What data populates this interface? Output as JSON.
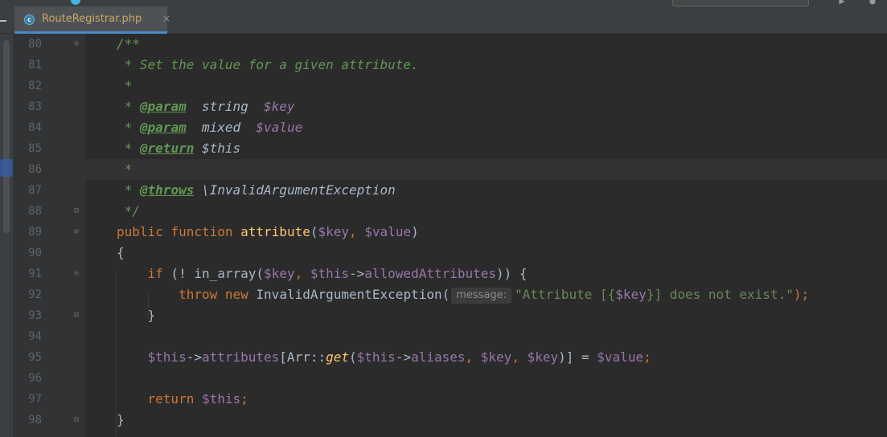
{
  "topbar": {
    "breadcrumb_text": "\\ ... \\ ... > ..."
  },
  "tab": {
    "icon_letter": "c",
    "title": "RouteRegistrar.php",
    "close_glyph": "×"
  },
  "editor": {
    "lines": [
      {
        "num": "80"
      },
      {
        "num": "81"
      },
      {
        "num": "82"
      },
      {
        "num": "83"
      },
      {
        "num": "84"
      },
      {
        "num": "85"
      },
      {
        "num": "86"
      },
      {
        "num": "87"
      },
      {
        "num": "88"
      },
      {
        "num": "89"
      },
      {
        "num": "90"
      },
      {
        "num": "91"
      },
      {
        "num": "92"
      },
      {
        "num": "93"
      },
      {
        "num": "94"
      },
      {
        "num": "95"
      },
      {
        "num": "96"
      },
      {
        "num": "97"
      },
      {
        "num": "98"
      }
    ],
    "code": {
      "l80": "/**",
      "l81": " * Set the value for a given attribute.",
      "l82": " *",
      "l83_star": " * ",
      "l83_tag": "@param",
      "l83_type": "  string  ",
      "l83_var": "$key",
      "l84_star": " * ",
      "l84_tag": "@param",
      "l84_type": "  mixed  ",
      "l84_var": "$value",
      "l85_star": " * ",
      "l85_tag": "@return",
      "l85_type": " $this",
      "l86": " *",
      "l87_star": " * ",
      "l87_tag": "@throws",
      "l87_type": " \\InvalidArgumentException",
      "l88": " */",
      "l89_kw1": "public",
      "l89_kw2": "function",
      "l89_fn": "attribute",
      "l89_p1": "(",
      "l89_v1": "$key",
      "l89_c1": ", ",
      "l89_v2": "$value",
      "l89_p2": ")",
      "l90": "{",
      "l91_kw": "if",
      "l91_a": " (! in_array(",
      "l91_v1": "$key",
      "l91_c1": ", ",
      "l91_v2": "$this",
      "l91_arrow": "->",
      "l91_prop": "allowedAttributes",
      "l91_b": ")) {",
      "l92_kw1": "throw",
      "l92_kw2": "new",
      "l92_cls": " InvalidArgumentException(",
      "l92_hint": "message:",
      "l92_s1": "\"Attribute [{",
      "l92_sv": "$key",
      "l92_s2": "}] does not exist.\"",
      "l92_end": ");",
      "l93": "}",
      "l95_v1": "$this",
      "l95_arrow": "->",
      "l95_prop": "attributes",
      "l95_a": "[Arr::",
      "l95_fn": "get",
      "l95_b": "(",
      "l95_v2": "$this",
      "l95_arrow2": "->",
      "l95_prop2": "aliases",
      "l95_c1": ", ",
      "l95_v3": "$key",
      "l95_c2": ", ",
      "l95_v4": "$key",
      "l95_c": ")] = ",
      "l95_v5": "$value",
      "l95_end": ";",
      "l97_kw": "return",
      "l97_v": " $this",
      "l97_end": ";",
      "l98": "}"
    }
  },
  "colors": {
    "background": "#2b2b2b",
    "keyword": "#cc7832",
    "function": "#ffc66d",
    "variable": "#9876aa",
    "string": "#6a8759",
    "doc_comment": "#629755",
    "plain": "#a9b7c6",
    "line_number": "#606366"
  }
}
